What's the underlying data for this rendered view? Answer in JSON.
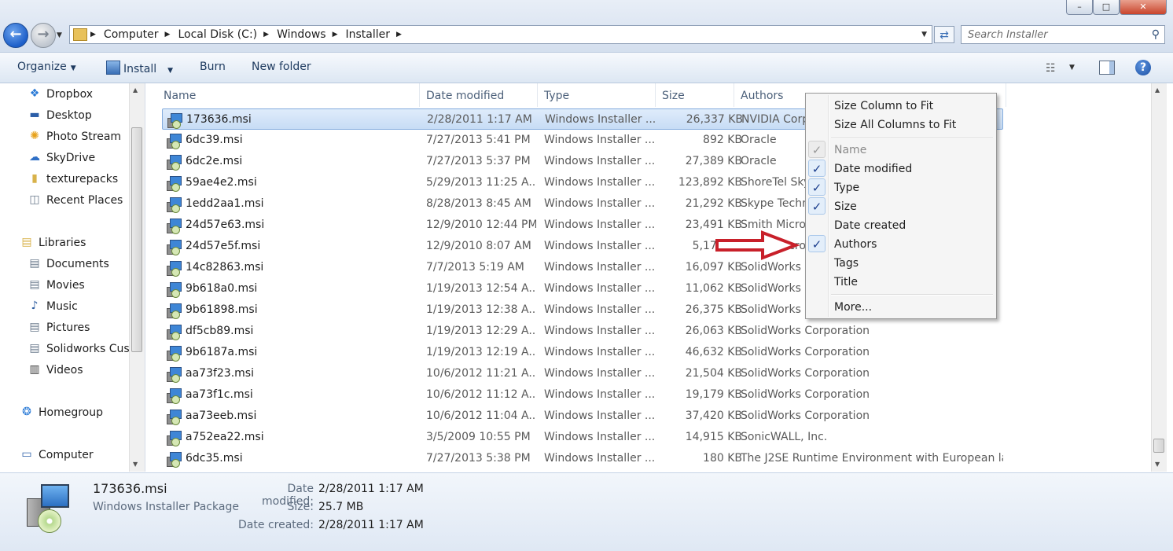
{
  "window": {
    "title_buttons": [
      "–",
      "□",
      "✕"
    ]
  },
  "address": {
    "breadcrumbs": [
      "Computer",
      "Local Disk (C:)",
      "Windows",
      "Installer"
    ],
    "search_placeholder": "Search Installer"
  },
  "toolbar": {
    "organize": "Organize",
    "install": "Install",
    "burn": "Burn",
    "new_folder": "New folder"
  },
  "nav": {
    "items": [
      {
        "label": "Dropbox",
        "icon": "dropbox-icon"
      },
      {
        "label": "Desktop",
        "icon": "desktop-icon"
      },
      {
        "label": "Photo Stream",
        "icon": "photo-stream-icon"
      },
      {
        "label": "SkyDrive",
        "icon": "skydrive-icon"
      },
      {
        "label": "texturepacks",
        "icon": "folder-icon"
      },
      {
        "label": "Recent Places",
        "icon": "recent-places-icon"
      },
      {
        "label": "Libraries",
        "icon": "libraries-icon"
      },
      {
        "label": "Documents",
        "icon": "documents-icon"
      },
      {
        "label": "Movies",
        "icon": "movies-icon"
      },
      {
        "label": "Music",
        "icon": "music-icon"
      },
      {
        "label": "Pictures",
        "icon": "pictures-icon"
      },
      {
        "label": "Solidworks Cust",
        "icon": "library-icon"
      },
      {
        "label": "Videos",
        "icon": "videos-icon"
      },
      {
        "label": "Homegroup",
        "icon": "homegroup-icon"
      },
      {
        "label": "Computer",
        "icon": "computer-icon"
      }
    ]
  },
  "columns": [
    "Name",
    "Date modified",
    "Type",
    "Size",
    "Authors"
  ],
  "files": [
    {
      "name": "173636.msi",
      "date": "2/28/2011 1:17 AM",
      "type": "Windows Installer ...",
      "size": "26,337 KB",
      "authors": "NVIDIA Corp"
    },
    {
      "name": "6dc39.msi",
      "date": "7/27/2013 5:41 PM",
      "type": "Windows Installer ...",
      "size": "892 KB",
      "authors": "Oracle"
    },
    {
      "name": "6dc2e.msi",
      "date": "7/27/2013 5:37 PM",
      "type": "Windows Installer ...",
      "size": "27,389 KB",
      "authors": "Oracle"
    },
    {
      "name": "59ae4e2.msi",
      "date": "5/29/2013 11:25 A...",
      "type": "Windows Installer ...",
      "size": "123,892 KB",
      "authors": "ShoreTel Sky"
    },
    {
      "name": "1edd2aa1.msi",
      "date": "8/28/2013 8:45 AM",
      "type": "Windows Installer ...",
      "size": "21,292 KB",
      "authors": "Skype Techn"
    },
    {
      "name": "24d57e63.msi",
      "date": "12/9/2010 12:44 PM",
      "type": "Windows Installer ...",
      "size": "23,491 KB",
      "authors": "Smith Micro"
    },
    {
      "name": "24d57e5f.msi",
      "date": "12/9/2010 8:07 AM",
      "type": "Windows Installer ...",
      "size": "5,170 KB",
      "authors": "Smith Micro"
    },
    {
      "name": "14c82863.msi",
      "date": "7/7/2013 5:19 AM",
      "type": "Windows Installer ...",
      "size": "16,097 KB",
      "authors": "SolidWorks C"
    },
    {
      "name": "9b618a0.msi",
      "date": "1/19/2013 12:54 A...",
      "type": "Windows Installer ...",
      "size": "11,062 KB",
      "authors": "SolidWorks C"
    },
    {
      "name": "9b61898.msi",
      "date": "1/19/2013 12:38 A...",
      "type": "Windows Installer ...",
      "size": "26,375 KB",
      "authors": "SolidWorks C"
    },
    {
      "name": "df5cb89.msi",
      "date": "1/19/2013 12:29 A...",
      "type": "Windows Installer ...",
      "size": "26,063 KB",
      "authors": "SolidWorks Corporation"
    },
    {
      "name": "9b6187a.msi",
      "date": "1/19/2013 12:19 A...",
      "type": "Windows Installer ...",
      "size": "46,632 KB",
      "authors": "SolidWorks Corporation"
    },
    {
      "name": "aa73f23.msi",
      "date": "10/6/2012 11:21 A...",
      "type": "Windows Installer ...",
      "size": "21,504 KB",
      "authors": "SolidWorks Corporation"
    },
    {
      "name": "aa73f1c.msi",
      "date": "10/6/2012 11:12 A...",
      "type": "Windows Installer ...",
      "size": "19,179 KB",
      "authors": "SolidWorks Corporation"
    },
    {
      "name": "aa73eeb.msi",
      "date": "10/6/2012 11:04 A...",
      "type": "Windows Installer ...",
      "size": "37,420 KB",
      "authors": "SolidWorks Corporation"
    },
    {
      "name": "a752ea22.msi",
      "date": "3/5/2009 10:55 PM",
      "type": "Windows Installer ...",
      "size": "14,915 KB",
      "authors": "SonicWALL, Inc."
    },
    {
      "name": "6dc35.msi",
      "date": "7/27/2013 5:38 PM",
      "type": "Windows Installer ...",
      "size": "180 KB",
      "authors": "The J2SE Runtime Environment with European la..."
    }
  ],
  "context_menu": {
    "size_column": "Size Column to Fit",
    "size_all": "Size All Columns to Fit",
    "columns": [
      {
        "label": "Name",
        "checked": true,
        "disabled": true
      },
      {
        "label": "Date modified",
        "checked": true,
        "disabled": false
      },
      {
        "label": "Type",
        "checked": true,
        "disabled": false
      },
      {
        "label": "Size",
        "checked": true,
        "disabled": false
      },
      {
        "label": "Date created",
        "checked": false,
        "disabled": false
      },
      {
        "label": "Authors",
        "checked": true,
        "disabled": false
      },
      {
        "label": "Tags",
        "checked": false,
        "disabled": false
      },
      {
        "label": "Title",
        "checked": false,
        "disabled": false
      }
    ],
    "more": "More..."
  },
  "details": {
    "filename": "173636.msi",
    "filetype": "Windows Installer Package",
    "date_modified_label": "Date modified:",
    "date_modified": "2/28/2011 1:17 AM",
    "size_label": "Size:",
    "size": "25.7 MB",
    "date_created_label": "Date created:",
    "date_created": "2/28/2011 1:17 AM"
  },
  "colors": {
    "annotation_arrow": "#c8202a",
    "selection": "#cde0f7",
    "accent": "#1d5fc9"
  }
}
